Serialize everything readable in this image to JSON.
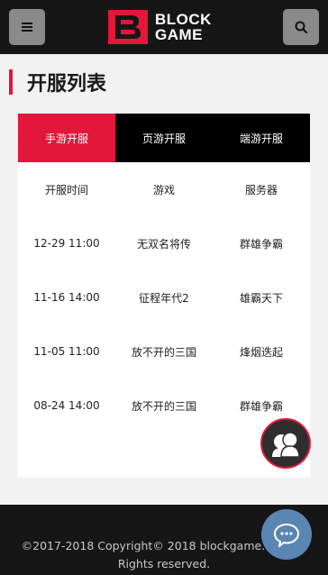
{
  "header": {
    "brand_line1": "BLOCK",
    "brand_line2": "GAME",
    "menu_icon": "hamburger-menu-icon",
    "search_icon": "search-icon"
  },
  "page_title": "开服列表",
  "tabs": [
    {
      "label": "手游开服",
      "active": true
    },
    {
      "label": "页游开服",
      "active": false
    },
    {
      "label": "端游开服",
      "active": false
    }
  ],
  "table": {
    "headers": [
      "开服时间",
      "游戏",
      "服务器"
    ],
    "rows": [
      [
        "12-29 11:00",
        "无双名将传",
        "群雄争霸"
      ],
      [
        "11-16 14:00",
        "征程年代2",
        "雄霸天下"
      ],
      [
        "11-05 11:00",
        "放不开的三国",
        "烽烟迭起"
      ],
      [
        "08-24 14:00",
        "放不开的三国",
        "群雄争霸"
      ]
    ]
  },
  "footer": {
    "copyright": "©2017-2018 Copyright© 2018 blockgame.com All Rights reserved."
  },
  "colors": {
    "accent": "#e3173a",
    "header_bg": "#161616",
    "chat_bg": "#5a86b3"
  }
}
